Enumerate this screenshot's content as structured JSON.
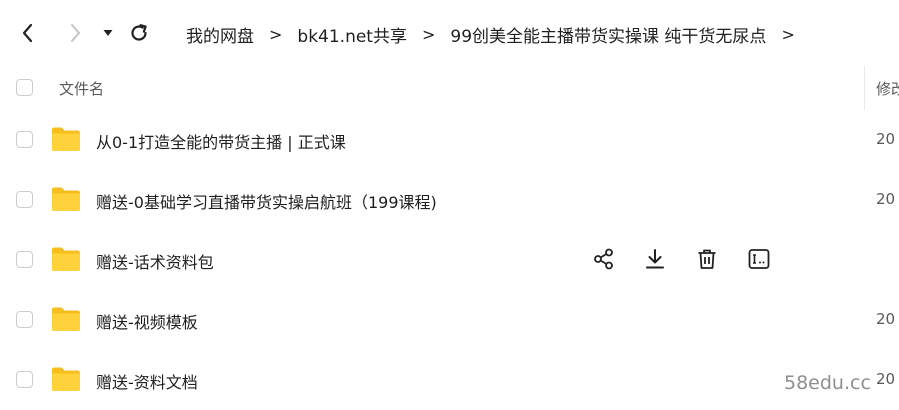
{
  "navbar": {
    "breadcrumbs": [
      {
        "label": "我的网盘"
      },
      {
        "label": "bk41.net共享"
      },
      {
        "label": "99创美全能主播带货实操课 纯干货无尿点"
      }
    ],
    "separator": ">"
  },
  "table": {
    "columns": {
      "name": "文件名",
      "modified": "修改"
    },
    "rows": [
      {
        "name": "从0-1打造全能的带货主播 | 正式课",
        "date": "20"
      },
      {
        "name": "赠送-0基础学习直播带货实操启航班（199课程)",
        "date": "20"
      },
      {
        "name": "赠送-话术资料包",
        "date": ""
      },
      {
        "name": "赠送-视频模板",
        "date": "20"
      },
      {
        "name": "赠送-资料文档",
        "date": "20"
      }
    ]
  },
  "colors": {
    "folder": "#FFD23C",
    "folder_dark": "#F6BE1E",
    "checkbox_border": "#c9ccd2",
    "text": "#1f1f1f",
    "muted": "#595959"
  },
  "icons": [
    "back-arrow-icon",
    "forward-arrow-icon",
    "dropdown-triangle-icon",
    "refresh-icon",
    "folder-icon",
    "share-icon",
    "download-icon",
    "delete-icon",
    "rename-icon"
  ],
  "watermark": "58edu.cc"
}
